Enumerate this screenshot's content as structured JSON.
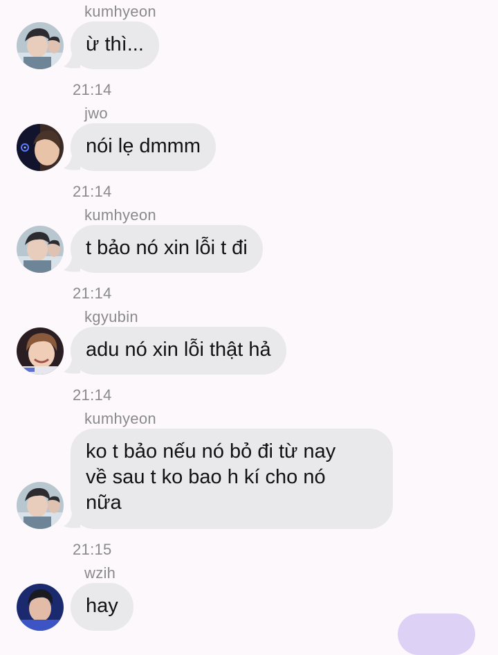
{
  "messages": [
    {
      "sender": "kumhyeon",
      "text": "ừ thì...",
      "avatar": "avatar-kumhyeon"
    },
    {
      "time": "21:14",
      "sender": "jwo",
      "text": "nói lẹ dmmm",
      "avatar": "avatar-jwo"
    },
    {
      "time": "21:14",
      "sender": "kumhyeon",
      "text": "t bảo nó xin lỗi t đi",
      "avatar": "avatar-kumhyeon"
    },
    {
      "time": "21:14",
      "sender": "kgyubin",
      "text": "adu nó xin lỗi thật hả",
      "avatar": "avatar-kgyubin"
    },
    {
      "time": "21:14",
      "sender": "kumhyeon",
      "text_lines": [
        "ko t bảo nếu nó bỏ đi từ nay",
        "về sau t ko bao h kí cho nó",
        "nữa"
      ],
      "avatar": "avatar-kumhyeon"
    },
    {
      "time": "21:15",
      "sender": "wzih",
      "text": "hay",
      "avatar": "avatar-wzih"
    }
  ],
  "colors": {
    "background": "#fcf8fc",
    "incoming_bubble": "#e9e9ec",
    "outgoing_bubble": "#ddd2f6",
    "meta_text": "#8a8a8e"
  }
}
